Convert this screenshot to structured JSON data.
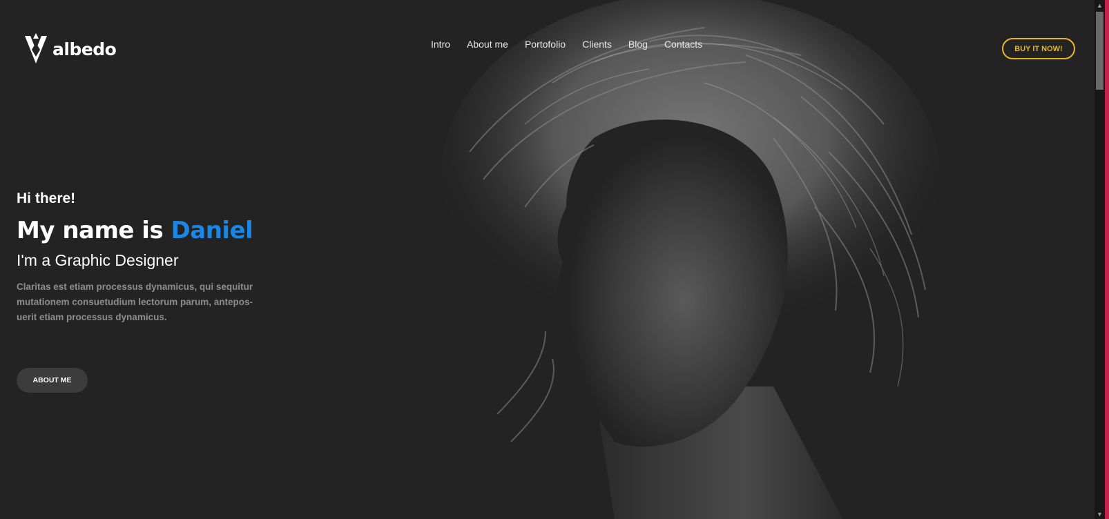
{
  "brand": {
    "name": "albedo",
    "logo_icon": "diamond-v-logo-icon"
  },
  "nav": {
    "items": [
      "Intro",
      "About me",
      "Portofolio",
      "Clients",
      "Blog",
      "Contacts"
    ]
  },
  "header": {
    "buy_label": "BUY IT NOW!"
  },
  "hero": {
    "greeting": "Hi there!",
    "headline_prefix": "My name is ",
    "headline_name": "Daniel",
    "subtitle": "I'm a Graphic Designer",
    "description": "Claritas est etiam processus dynamicus, qui sequitur mutationem consuetudium lectorum parum, antepos-uerit etiam processus dynamicus.",
    "button_label": "ABOUT ME"
  },
  "colors": {
    "background": "#232323",
    "accent_blue": "#1a86e5",
    "accent_yellow": "#e9b726",
    "edge_accent": "#c8214f"
  }
}
